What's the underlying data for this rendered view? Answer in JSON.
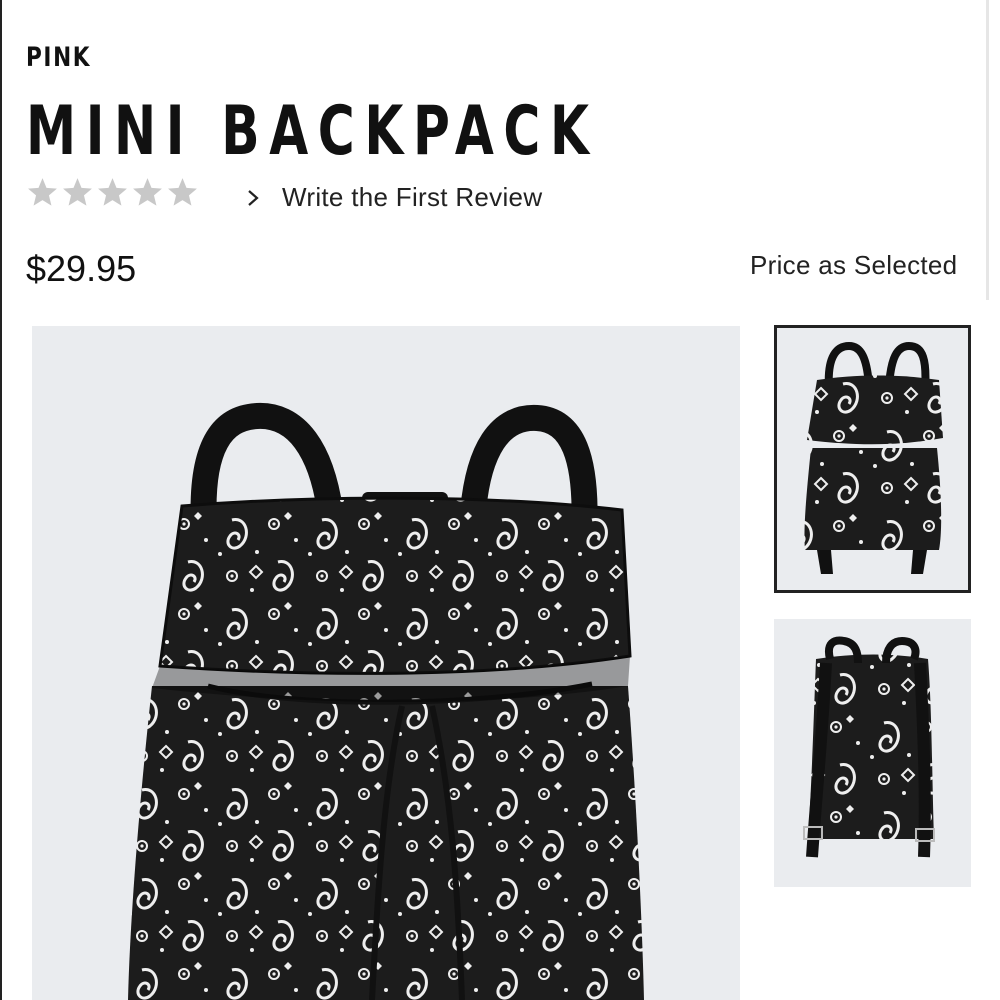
{
  "product": {
    "brand": "PINK",
    "title": "MINI BACKPACK",
    "rating": {
      "stars_filled": 0,
      "stars_total": 5,
      "review_link": "Write the First Review"
    },
    "price": "$29.95",
    "price_note": "Price as Selected"
  },
  "images": {
    "main": {
      "icon": "backpack-front-image"
    },
    "thumbnails": [
      {
        "icon": "backpack-front-thumbnail",
        "selected": true
      },
      {
        "icon": "backpack-back-thumbnail",
        "selected": false
      }
    ]
  },
  "colors": {
    "text": "#111111",
    "star_empty": "#c8c8c8",
    "image_bg": "#eaecef",
    "bag_black": "#1c1c1c",
    "pattern_white": "#eeeeee",
    "selected_border": "#222222"
  }
}
